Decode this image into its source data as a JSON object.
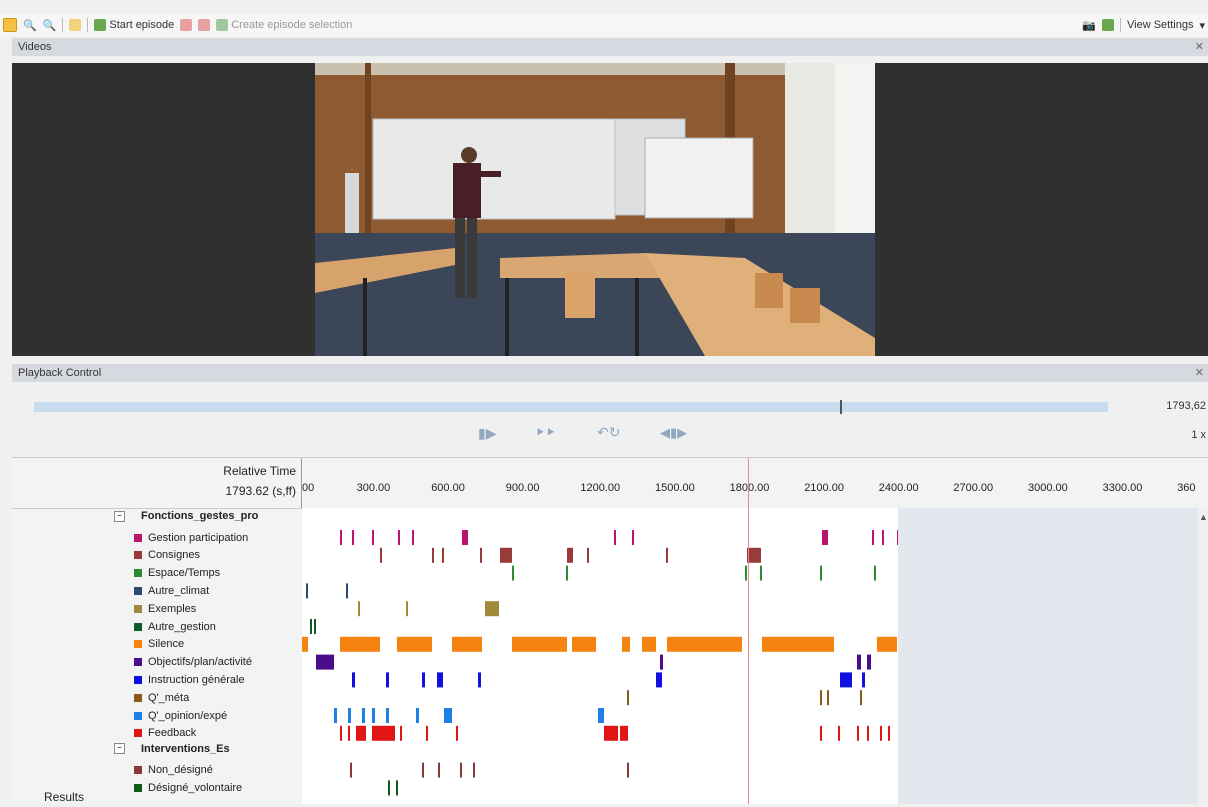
{
  "toolbar": {
    "start_episode": "Start episode",
    "create_selection": "Create episode selection",
    "view_settings": "View Settings"
  },
  "videos_panel": {
    "title": "Videos"
  },
  "playback": {
    "title": "Playback Control",
    "time": "1793,62",
    "speed": "1 x",
    "position_fraction": 0.75
  },
  "timeline": {
    "relative_time_label": "Relative Time",
    "current_time": "1793.62 (s,ff)",
    "current_value": 1793.62,
    "ticks": [
      "00",
      "300.00",
      "600.00",
      "900.00",
      "1200.00",
      "1500.00",
      "1800.00",
      "2100.00",
      "2400.00",
      "2700.00",
      "3000.00",
      "3300.00",
      "360"
    ],
    "results_label": "Results"
  },
  "groups": [
    {
      "name": "Fonctions_gestes_pro",
      "items": [
        {
          "label": "Gestion participation",
          "color": "#b8156f"
        },
        {
          "label": "Consignes",
          "color": "#9a3b3b"
        },
        {
          "label": "Espace/Temps",
          "color": "#2e8b2e"
        },
        {
          "label": "Autre_climat",
          "color": "#2d4a6b"
        },
        {
          "label": "Exemples",
          "color": "#a08a3a"
        },
        {
          "label": "Autre_gestion",
          "color": "#0e5a2a"
        },
        {
          "label": "Silence",
          "color": "#f58310"
        },
        {
          "label": "Objectifs/plan/activité",
          "color": "#4b0d8c"
        },
        {
          "label": "Instruction générale",
          "color": "#1010e0"
        },
        {
          "label": "Q'_méta",
          "color": "#8a5a1a"
        },
        {
          "label": "Q'_opinion/expé",
          "color": "#1e7fe6"
        },
        {
          "label": "Feedback",
          "color": "#e21515"
        }
      ]
    },
    {
      "name": "Interventions_Es",
      "items": [
        {
          "label": "Non_désigné",
          "color": "#8b3a3a"
        },
        {
          "label": "Désigné_volontaire",
          "color": "#0e5a1a"
        }
      ]
    }
  ]
}
